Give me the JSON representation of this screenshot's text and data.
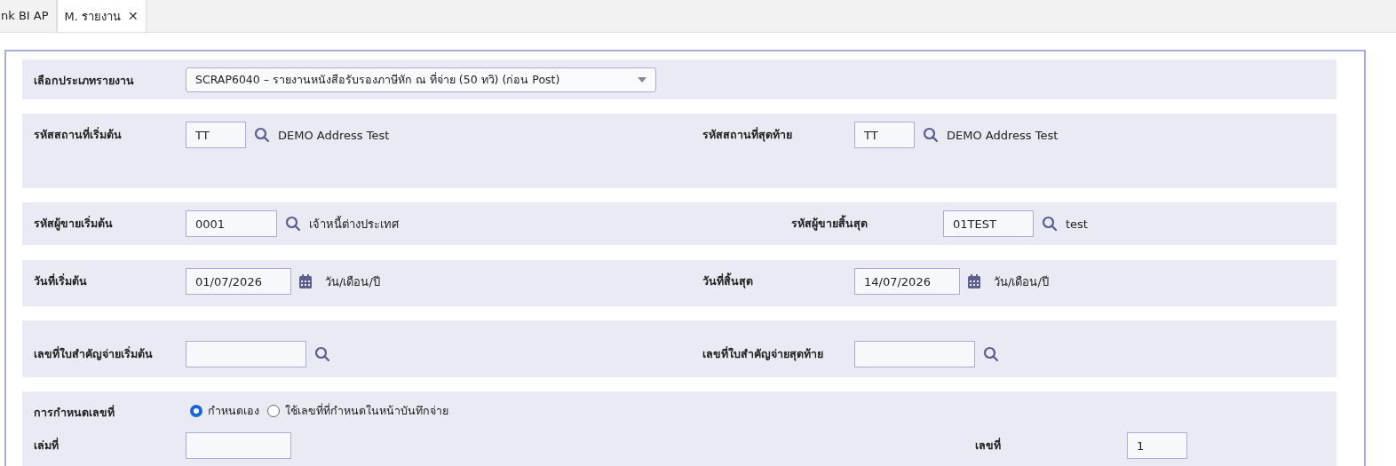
{
  "tabs": [
    {
      "label": "nk BI AP",
      "selected": false
    },
    {
      "label": "M. รายงาน",
      "selected": true,
      "close": "✕"
    }
  ],
  "sections": [
    {
      "lines": [
        {
          "cells": [
            {
              "label": "เลือกประเภทรายงาน",
              "control": {
                "kind": "select",
                "value": "SCRAP6040 – รายงานหนังสือรับรองภาษีหัก ณ ที่จ่าย (50 ทวิ) (ก่อน Post)"
              }
            }
          ]
        }
      ]
    },
    {
      "lines": [
        {
          "cells": [
            {
              "label": "รหัสสถานที่เริ่มต้น",
              "control": {
                "kind": "lookup",
                "value": "TT",
                "description": "DEMO Address Test"
              }
            },
            {
              "label": "รหัสสถานที่สุดท้าย",
              "control": {
                "kind": "lookup",
                "value": "TT",
                "description": "DEMO Address Test"
              }
            }
          ]
        }
      ]
    },
    {
      "lines": [
        {
          "cells": [
            {
              "label": "รหัสผู้ขายเริ่มต้น",
              "control": {
                "kind": "lookup",
                "value": "0001",
                "description": "เจ้าหนี้ต่างประเทศ"
              }
            },
            {
              "label": "รหัสผู้ขายสิ้นสุด",
              "control": {
                "kind": "lookup",
                "value": "01TEST",
                "description": "test"
              }
            }
          ]
        }
      ]
    },
    {
      "lines": [
        {
          "cells": [
            {
              "label": "วันที่เริ่มต้น",
              "control": {
                "kind": "date",
                "value": "01/07/2026",
                "hint": "วัน/เดือน/ปี"
              }
            },
            {
              "label": "วันที่สิ้นสุด",
              "control": {
                "kind": "date",
                "value": "14/07/2026",
                "hint": "วัน/เดือน/ปี"
              }
            }
          ]
        }
      ]
    },
    {
      "lines": [
        {
          "cells": [
            {
              "label": "เลขที่ใบสำคัญจ่ายเริ่มต้น",
              "control": {
                "kind": "lookup"
              }
            },
            {
              "label": "เลขที่ใบสำคัญจ่ายสุดท้าย",
              "control": {
                "kind": "lookup"
              }
            }
          ]
        }
      ]
    },
    {
      "lines": [
        {
          "cells": [
            {
              "label": "การกำหนดเลขที่",
              "control": {
                "kind": "radio",
                "options": [
                  {
                    "label": "กำหนดเอง",
                    "selected": true
                  },
                  {
                    "label": "ใช้เลขที่ที่กำหนดในหน้าบันทึกจ่าย",
                    "selected": false
                  }
                ]
              }
            }
          ]
        },
        {
          "cells": [
            {
              "label": "เล่มที่",
              "control": {
                "kind": "text"
              }
            },
            {
              "label": "เลขที่",
              "control": {
                "kind": "text",
                "value": "1"
              }
            }
          ]
        }
      ]
    }
  ]
}
